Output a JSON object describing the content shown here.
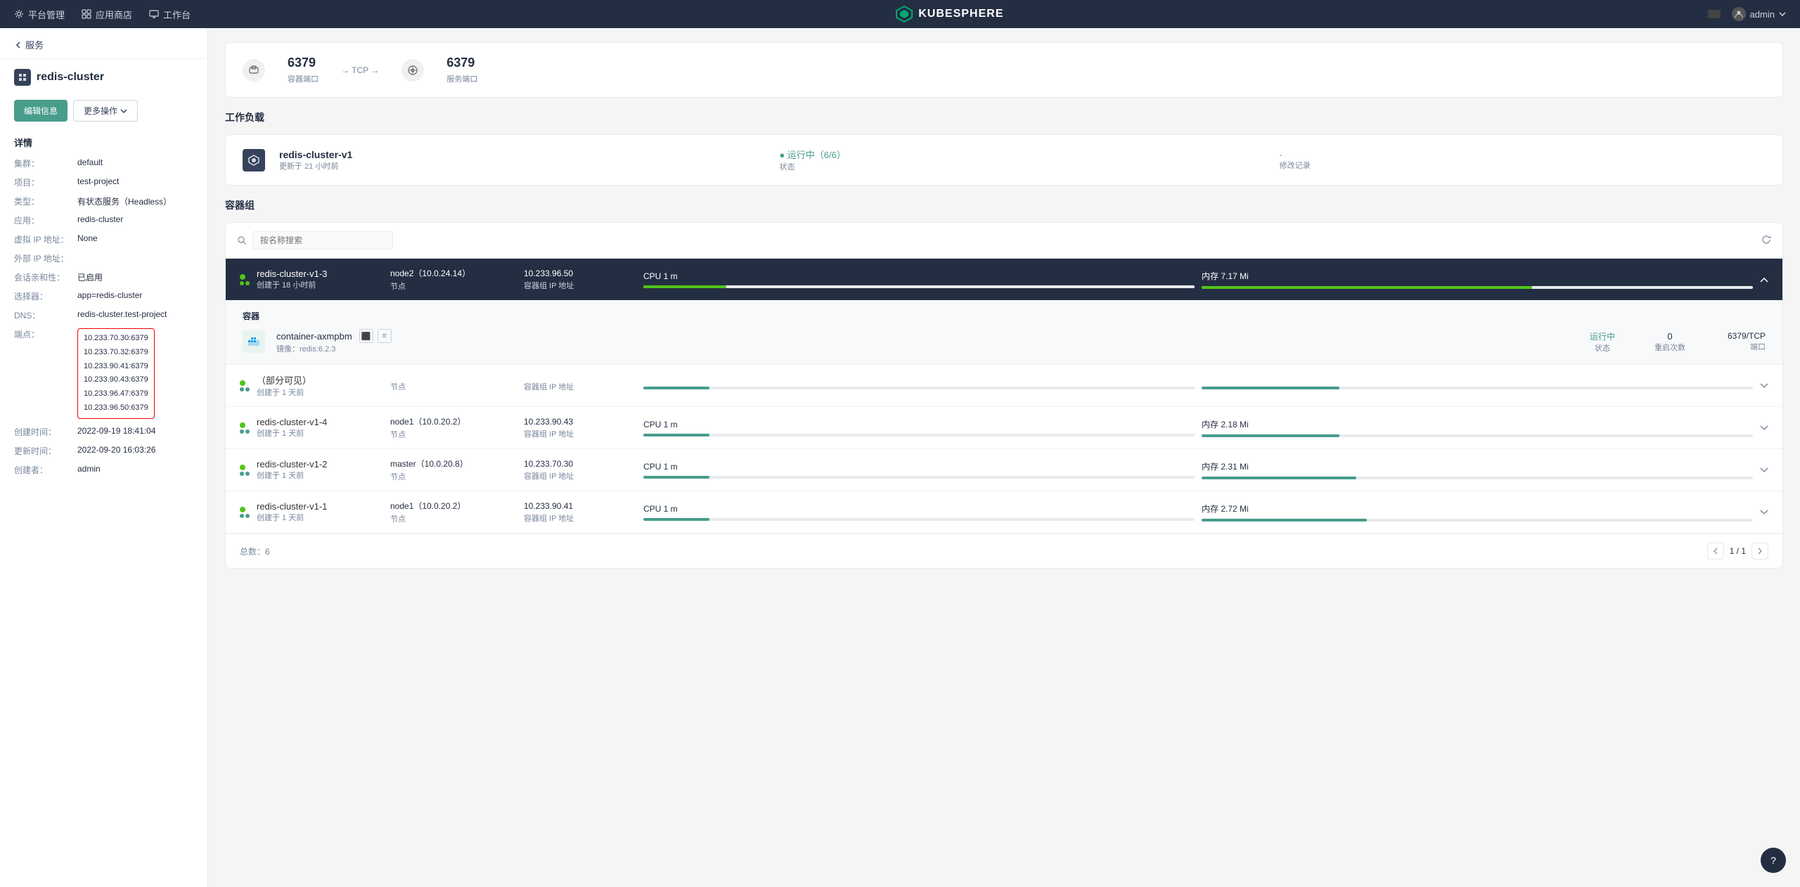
{
  "topNav": {
    "items": [
      {
        "id": "platform",
        "label": "平台管理",
        "icon": "gear"
      },
      {
        "id": "appstore",
        "label": "应用商店",
        "icon": "store"
      },
      {
        "id": "workbench",
        "label": "工作台",
        "icon": "desktop"
      }
    ],
    "brand": "KUBESPHERE",
    "admin": "admin"
  },
  "sidebar": {
    "backLabel": "服务",
    "resourceName": "redis-cluster",
    "actions": {
      "edit": "编辑信息",
      "more": "更多操作"
    },
    "detailsTitle": "详情",
    "details": {
      "cluster": {
        "label": "集群：",
        "value": "default"
      },
      "project": {
        "label": "项目：",
        "value": "test-project"
      },
      "type": {
        "label": "类型：",
        "value": "有状态服务（Headless）"
      },
      "app": {
        "label": "应用：",
        "value": "redis-cluster"
      },
      "virtualIP": {
        "label": "虚拟 IP 地址：",
        "value": "None"
      },
      "externalIP": {
        "label": "外部 IP 地址：",
        "value": ""
      },
      "affinity": {
        "label": "会话亲和性：",
        "value": "已启用"
      },
      "selector": {
        "label": "选择器：",
        "value": "app=redis-cluster"
      },
      "dns": {
        "label": "DNS：",
        "value": "redis-cluster.test-project"
      },
      "endpoints": {
        "label": "端点：",
        "values": [
          "10.233.70.30:6379",
          "10.233.70.32:6379",
          "10.233.90.41:6379",
          "10.233.90.43:6379",
          "10.233.96.47:6379",
          "10.233.96.50:6379"
        ]
      },
      "createdTime": {
        "label": "创建时间：",
        "value": "2022-09-19 18:41:04"
      },
      "updatedTime": {
        "label": "更新时间：",
        "value": "2022-09-20 16:03:26"
      },
      "creator": {
        "label": "创建者：",
        "value": "admin"
      }
    }
  },
  "main": {
    "ports": [
      {
        "number": "6379",
        "label": "容器端口",
        "protocol": "TCP"
      },
      {
        "number": "6379",
        "label": "服务端口"
      }
    ],
    "workloadTitle": "工作负载",
    "workload": {
      "name": "redis-cluster-v1",
      "updated": "更新于 21 小时前",
      "status": "● 运行中（6/6）",
      "statusLabel": "状态",
      "changes": "-",
      "changesLabel": "修改记录"
    },
    "containerGroupTitle": "容器组",
    "searchPlaceholder": "按名称搜索",
    "pods": [
      {
        "name": "redis-cluster-v1-3",
        "created": "创建于 18 小时前",
        "node": "node2（10.0.24.14）",
        "nodeLabel": "节点",
        "ip": "10.233.96.50",
        "ipLabel": "容器组 IP 地址",
        "cpu": "CPU 1 m",
        "cpuLabel": "",
        "cpuPercent": 15,
        "mem": "内存 7.17 Mi",
        "memPercent": 60,
        "expanded": true,
        "isHeader": true,
        "container": {
          "name": "container-axmpbm",
          "image": "镜像：redis:6.2.3",
          "status": "运行中",
          "statusLabel": "状态",
          "restarts": "0",
          "restartsLabel": "重启次数",
          "port": "6379/TCP",
          "portLabel": "端口"
        }
      },
      {
        "name": "redis-cluster-v1-4",
        "created": "创建于 1 天前",
        "node": "node1（10.0.20.2）",
        "nodeLabel": "节点",
        "ip": "10.233.90.43",
        "ipLabel": "容器组 IP 地址",
        "cpu": "CPU 1 m",
        "cpuPercent": 12,
        "mem": "内存 2.18 Mi",
        "memPercent": 30,
        "expanded": false
      },
      {
        "name": "redis-cluster-v1-2",
        "created": "创建于 1 天前",
        "node": "master（10.0.20.8）",
        "nodeLabel": "节点",
        "ip": "10.233.70.30",
        "ipLabel": "容器组 IP 地址",
        "cpu": "CPU 1 m",
        "cpuPercent": 12,
        "mem": "内存 2.31 Mi",
        "memPercent": 32,
        "expanded": false
      },
      {
        "name": "redis-cluster-v1-1",
        "created": "创建于 1 天前",
        "node": "node1（10.0.20.2）",
        "nodeLabel": "节点",
        "ip": "10.233.90.41",
        "ipLabel": "容器组 IP 地址",
        "cpu": "CPU 1 m",
        "cpuPercent": 12,
        "mem": "内存 2.72 Mi",
        "memPercent": 35,
        "expanded": false
      }
    ],
    "pagination": {
      "total": "总数：6",
      "page": "1 / 1"
    }
  }
}
